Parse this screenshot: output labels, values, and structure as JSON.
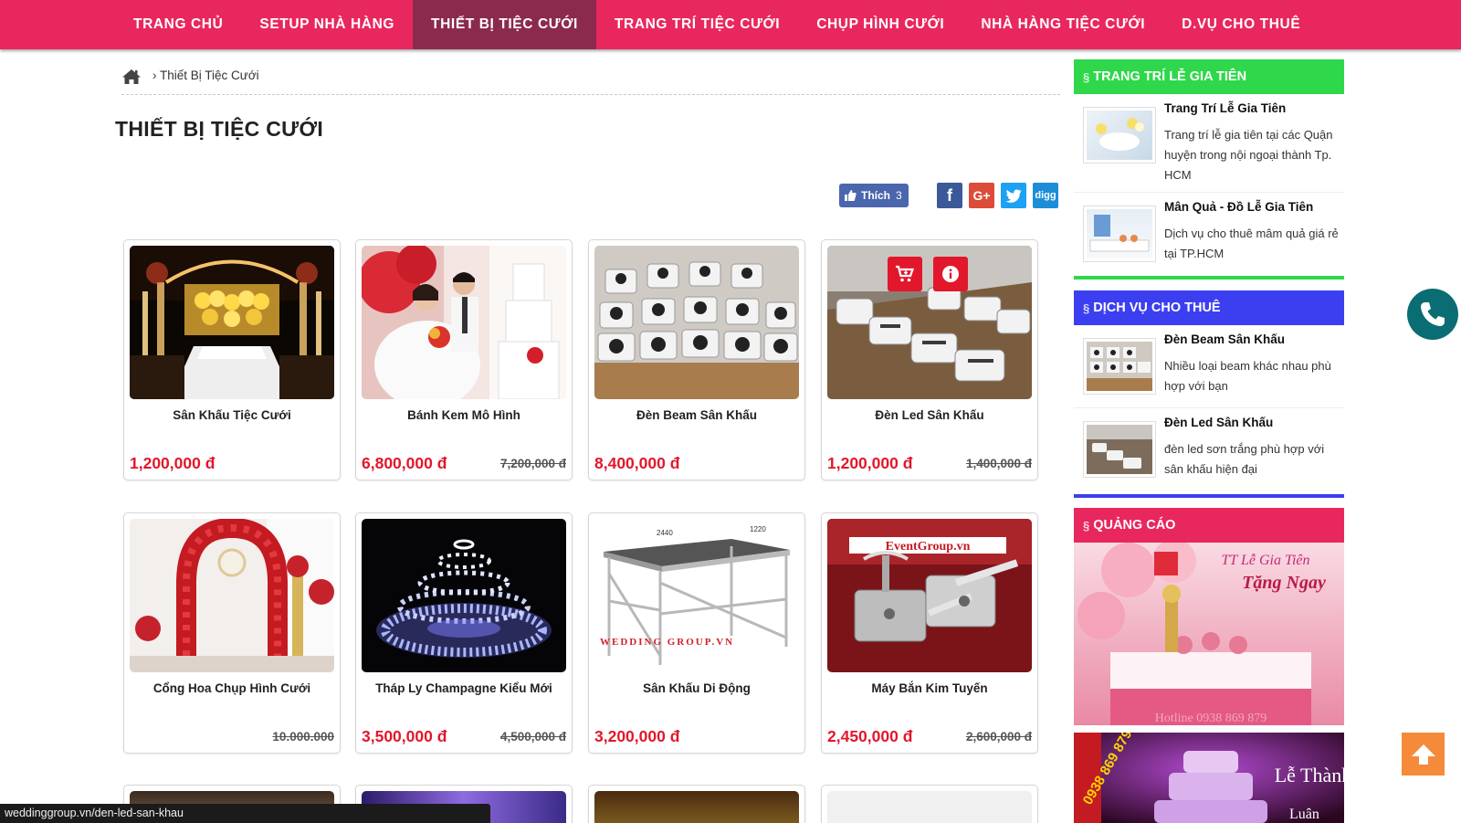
{
  "nav": {
    "items": [
      {
        "label": "TRANG CHỦ"
      },
      {
        "label": "SETUP NHÀ HÀNG"
      },
      {
        "label": "THIẾT BỊ TIỆC CƯỚI"
      },
      {
        "label": "TRANG TRÍ TIỆC CƯỚI"
      },
      {
        "label": "CHỤP HÌNH CƯỚI"
      },
      {
        "label": "NHÀ HÀNG TIỆC CƯỚI"
      },
      {
        "label": "D.VỤ CHO THUÊ"
      }
    ],
    "active_index": 2
  },
  "breadcrumb": {
    "current": "› Thiết Bị Tiệc Cưới"
  },
  "page_title": "THIẾT BỊ TIỆC CƯỚI",
  "share": {
    "like_label": "Thích",
    "like_count": "3",
    "digg_label": "digg"
  },
  "products": [
    {
      "name": "Sân Khấu Tiệc Cưới",
      "price": "1,200,000 đ",
      "old_price": ""
    },
    {
      "name": "Bánh Kem Mô Hình",
      "price": "6,800,000 đ",
      "old_price": "7,200,000 đ"
    },
    {
      "name": "Đèn Beam Sân Khấu",
      "price": "8,400,000 đ",
      "old_price": ""
    },
    {
      "name": "Đèn Led Sân Khấu",
      "price": "1,200,000 đ",
      "old_price": "1,400,000 đ"
    },
    {
      "name": "Cổng Hoa Chụp Hình Cưới",
      "price": "",
      "old_price": "10.000.000"
    },
    {
      "name": "Tháp Ly Champagne Kiểu Mới",
      "price": "3,500,000 đ",
      "old_price": "4,500,000 đ"
    },
    {
      "name": "Sân Khấu Di Động",
      "price": "3,200,000 đ",
      "old_price": ""
    },
    {
      "name": "Máy Bắn Kim Tuyến",
      "price": "2,450,000 đ",
      "old_price": "2,600,000 đ"
    }
  ],
  "image_texts": {
    "stage_dim_1": "2440",
    "stage_dim_2": "1220",
    "stage_watermark": "WEDDING GROUP.VN",
    "eventgroup": "EventGroup.vn",
    "ad_1_line1": "TT Lễ Gia Tiên",
    "ad_1_line2": "Tặng Ngay",
    "ad_1_hotline": "Hotline 0938 869 879",
    "ad_2_text": "Lễ Thành",
    "ad_2_text2": "Luân",
    "ad_2_phone": "0938 869 879"
  },
  "sidebar": {
    "boxes": [
      {
        "title": "TRANG TRÍ LỄ GIA TIÊN",
        "color": "#2ed84a",
        "items": [
          {
            "title": "Trang Trí Lễ Gia Tiên",
            "desc": "Trang trí lễ gia tiên tại các Quận huyện trong nội ngoại thành Tp. HCM"
          },
          {
            "title": "Mân Quả - Đồ Lễ Gia Tiên",
            "desc": "Dịch vụ cho thuê mâm quả giá rẻ tại TP.HCM"
          }
        ]
      },
      {
        "title": "DỊCH VỤ CHO THUÊ",
        "color": "#3c3ff0",
        "items": [
          {
            "title": "Đèn Beam Sân Khấu",
            "desc": "Nhiều loại beam khác nhau phù hợp với bạn"
          },
          {
            "title": "Đèn Led Sân Khấu",
            "desc": "đèn led sơn trắng phù hợp với sân khấu hiện đại"
          }
        ]
      },
      {
        "title": "QUẢNG CÁO",
        "color": "#e8275e"
      }
    ]
  },
  "status_bar": {
    "url": "weddinggroup.vn/den-led-san-khau"
  },
  "colors": {
    "brand": "#e8275e",
    "nav_active": "#8c2a4e",
    "price": "#e2172b",
    "green": "#2ed84a",
    "blue": "#3c3ff0",
    "orange": "#f58a3a",
    "teal": "#0a6d73"
  }
}
